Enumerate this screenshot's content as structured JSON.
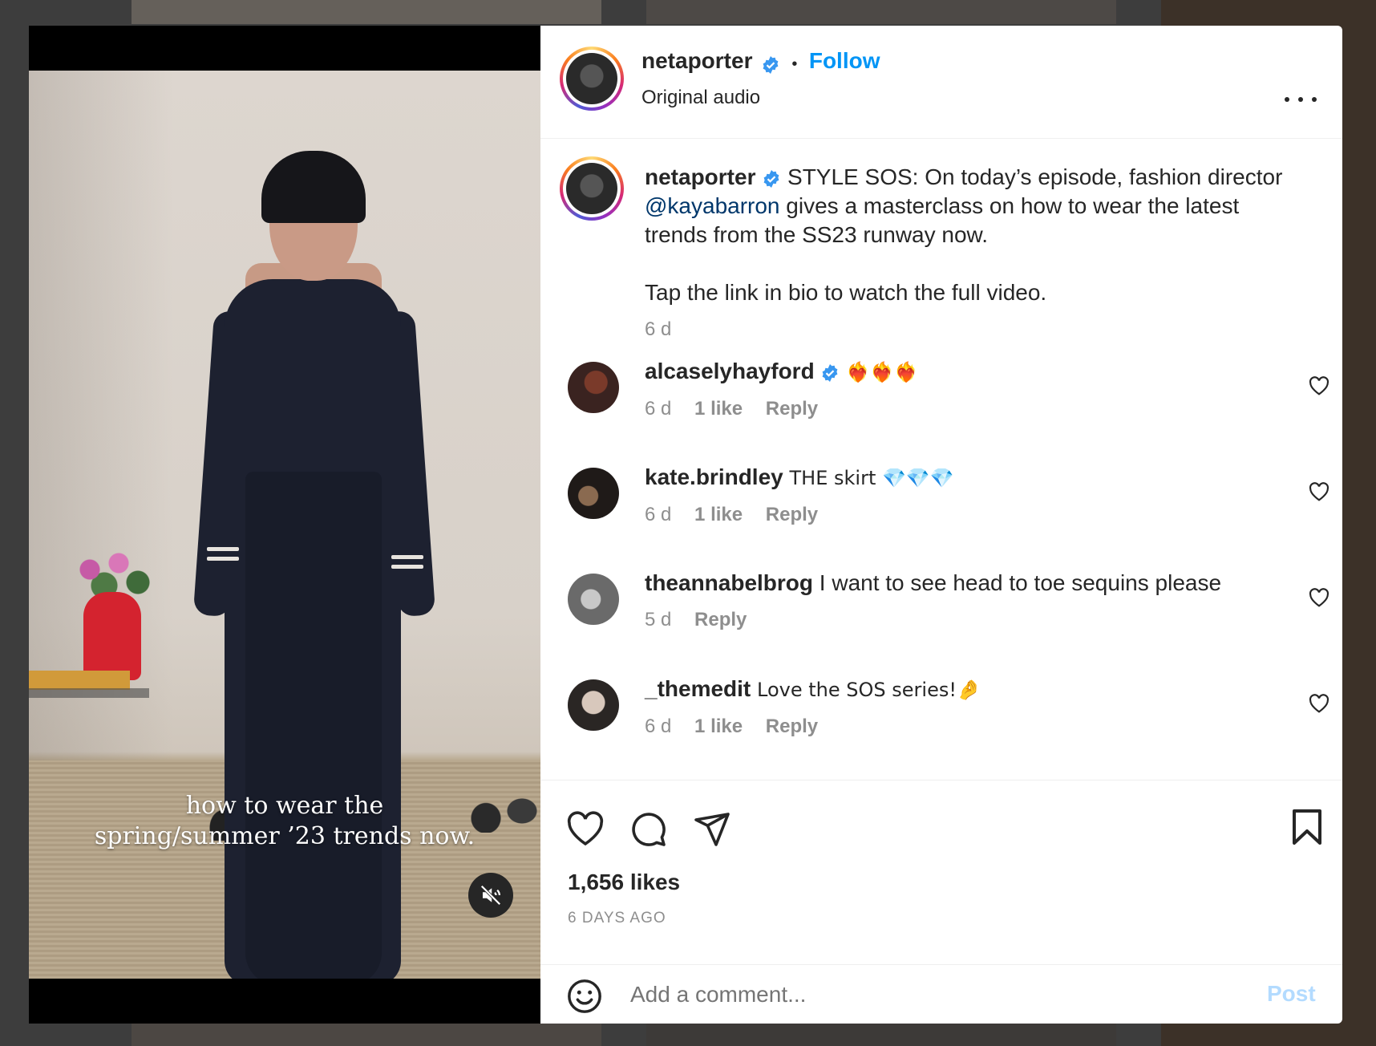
{
  "post": {
    "account": "netaporter",
    "follow_label": "Follow",
    "dot": "•",
    "audio": "Original audio",
    "video_caption_line1": "how to wear the",
    "video_caption_line2": "spring/summer ’23 trends now.",
    "caption_prefix": "STYLE SOS: On today’s episode, fashion director ",
    "caption_mention": "@kayabarron",
    "caption_suffix": " gives a masterclass on how to wear the latest trends from the SS23 runway now.",
    "caption_line2": "Tap the link in bio to watch the full video.",
    "caption_age": "6 d",
    "likes": "1,656 likes",
    "date": "6 DAYS AGO"
  },
  "comments": [
    {
      "user": "alcaselyhayford",
      "verified": true,
      "text": "❤️‍🔥❤️‍🔥❤️‍🔥",
      "age": "6 d",
      "likes": "1 like",
      "reply": "Reply"
    },
    {
      "user": "kate.brindley",
      "verified": false,
      "text": "THE skirt 💎💎💎",
      "age": "6 d",
      "likes": "1 like",
      "reply": "Reply"
    },
    {
      "user": "theannabelbrog",
      "verified": false,
      "text": "I want to see head to toe sequins please",
      "age": "5 d",
      "likes": "",
      "reply": "Reply"
    },
    {
      "user": "_themedit",
      "verified": false,
      "text": "Love the SOS series!🤌",
      "age": "6 d",
      "likes": "1 like",
      "reply": "Reply"
    }
  ],
  "composer": {
    "placeholder": "Add a comment...",
    "post_label": "Post"
  },
  "icons": {
    "verified": "verified-badge-icon",
    "more": "more-options-icon",
    "like": "heart-icon",
    "comment": "comment-icon",
    "share": "share-icon",
    "save": "bookmark-icon",
    "emoji": "emoji-icon",
    "mute": "muted-speaker-icon"
  },
  "colors": {
    "link_blue": "#0095f6",
    "mention": "#00376b",
    "verified": "#3897f0",
    "muted_text": "#8e8e8e",
    "post_disabled": "#b3dbff"
  }
}
